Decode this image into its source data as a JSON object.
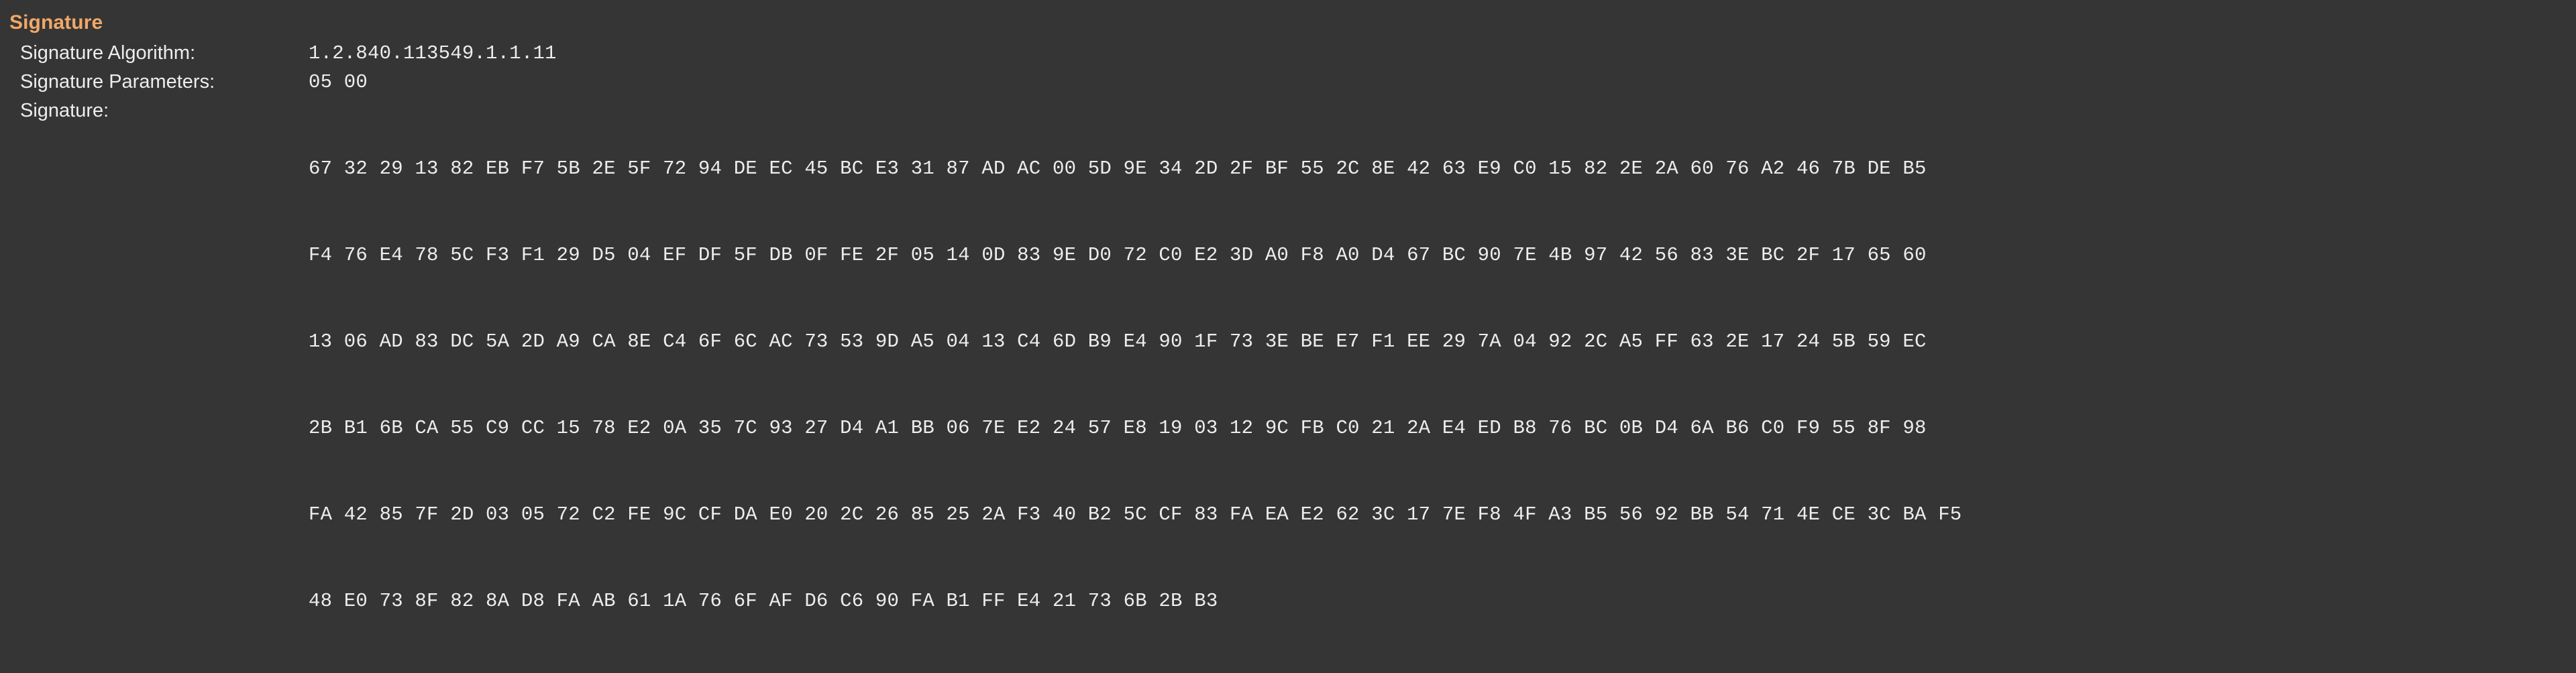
{
  "theme": {
    "background": "#353535",
    "heading_color": "#f0a868",
    "text_color": "#ededed"
  },
  "section": {
    "heading": "Signature"
  },
  "fields": [
    {
      "label": "Signature Algorithm:",
      "value": "1.2.840.113549.1.1.11"
    },
    {
      "label": "Signature Parameters:",
      "value": "05 00"
    }
  ],
  "signature": {
    "label": "Signature:",
    "hex_lines": [
      "67 32 29 13 82 EB F7 5B 2E 5F 72 94 DE EC 45 BC E3 31 87 AD AC 00 5D 9E 34 2D 2F BF 55 2C 8E 42 63 E9 C0 15 82 2E 2A 60 76 A2 46 7B DE B5",
      "F4 76 E4 78 5C F3 F1 29 D5 04 EF DF 5F DB 0F FE 2F 05 14 0D 83 9E D0 72 C0 E2 3D A0 F8 A0 D4 67 BC 90 7E 4B 97 42 56 83 3E BC 2F 17 65 60",
      "13 06 AD 83 DC 5A 2D A9 CA 8E C4 6F 6C AC 73 53 9D A5 04 13 C4 6D B9 E4 90 1F 73 3E BE E7 F1 EE 29 7A 04 92 2C A5 FF 63 2E 17 24 5B 59 EC",
      "2B B1 6B CA 55 C9 CC 15 78 E2 0A 35 7C 93 27 D4 A1 BB 06 7E E2 24 57 E8 19 03 12 9C FB C0 21 2A E4 ED B8 76 BC 0B D4 6A B6 C0 F9 55 8F 98",
      "FA 42 85 7F 2D 03 05 72 C2 FE 9C CF DA E0 20 2C 26 85 25 2A F3 40 B2 5C CF 83 FA EA E2 62 3C 17 7E F8 4F A3 B5 56 92 BB 54 71 4E CE 3C BA F5",
      "48 E0 73 8F 82 8A D8 FA AB 61 1A 76 6F AF D6 C6 90 FA B1 FF E4 21 73 6B 2B B3"
    ]
  }
}
